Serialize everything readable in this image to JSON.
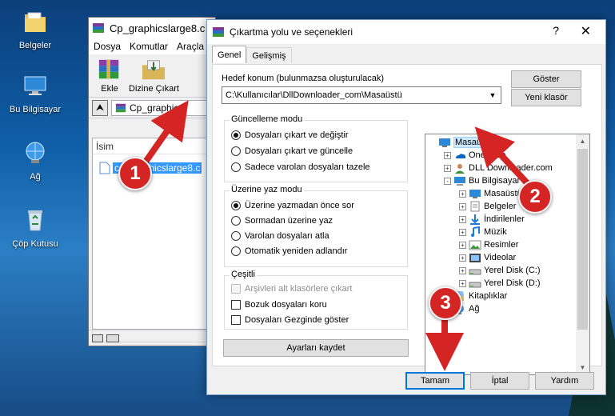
{
  "desktop": {
    "icons": [
      {
        "label": "Belgeler",
        "icon": "folder-documents-icon"
      },
      {
        "label": "Bu Bilgisayar",
        "icon": "computer-icon"
      },
      {
        "label": "Ağ",
        "icon": "network-icon"
      },
      {
        "label": "Çöp Kutusu",
        "icon": "recycle-bin-icon"
      }
    ]
  },
  "winrar": {
    "title": "Cp_graphicslarge8.c",
    "menu": [
      "Dosya",
      "Komutlar",
      "Araçla"
    ],
    "toolbar": {
      "add": "Ekle",
      "extract_to": "Dizine Çıkart"
    },
    "path": "Cp_graphic",
    "column": "İsim",
    "file": "cp_graphicslarge8.c"
  },
  "dialog": {
    "title": "Çıkartma yolu ve seçenekleri",
    "help": "?",
    "close": "✕",
    "tabs": [
      "Genel",
      "Gelişmiş"
    ],
    "dest_label": "Hedef konum (bulunmazsa oluşturulacak)",
    "dest_value": "C:\\Kullanıcılar\\DllDownloader_com\\Masaüstü",
    "show_btn": "Göster",
    "new_folder_btn": "Yeni klasör",
    "update_mode": {
      "title": "Güncelleme modu",
      "options": [
        "Dosyaları çıkart ve değiştir",
        "Dosyaları çıkart ve güncelle",
        "Sadece varolan dosyaları tazele"
      ],
      "selected": 0
    },
    "overwrite_mode": {
      "title": "Üzerine yaz modu",
      "options": [
        "Üzerine yazmadan önce sor",
        "Sormadan üzerine yaz",
        "Varolan dosyaları atla",
        "Otomatik yeniden adlandır"
      ],
      "selected": 0
    },
    "misc": {
      "title": "Çeşitli",
      "options": [
        "Arşivleri alt klasörlere çıkart",
        "Bozuk dosyaları koru",
        "Dosyaları Gezginde göster"
      ],
      "disabled": [
        true,
        false,
        false
      ]
    },
    "save_settings_btn": "Ayarları kaydet",
    "tree": [
      {
        "label": "Masaüstü",
        "level": 0,
        "exp": "",
        "icon": "desktop-icon",
        "selected": true
      },
      {
        "label": "OneDrive",
        "level": 1,
        "exp": "+",
        "icon": "onedrive-icon"
      },
      {
        "label": "DLL Downloader.com",
        "level": 1,
        "exp": "+",
        "icon": "user-icon"
      },
      {
        "label": "Bu Bilgisayar",
        "level": 1,
        "exp": "-",
        "icon": "computer-icon"
      },
      {
        "label": "Masaüstü",
        "level": 2,
        "exp": "+",
        "icon": "desktop-icon"
      },
      {
        "label": "Belgeler",
        "level": 2,
        "exp": "+",
        "icon": "documents-icon"
      },
      {
        "label": "İndirilenler",
        "level": 2,
        "exp": "+",
        "icon": "download-icon"
      },
      {
        "label": "Müzik",
        "level": 2,
        "exp": "+",
        "icon": "music-icon"
      },
      {
        "label": "Resimler",
        "level": 2,
        "exp": "+",
        "icon": "pictures-icon"
      },
      {
        "label": "Videolar",
        "level": 2,
        "exp": "+",
        "icon": "videos-icon"
      },
      {
        "label": "Yerel Disk (C:)",
        "level": 2,
        "exp": "+",
        "icon": "drive-icon"
      },
      {
        "label": "Yerel Disk (D:)",
        "level": 2,
        "exp": "+",
        "icon": "drive-icon"
      },
      {
        "label": "Kitaplıklar",
        "level": 1,
        "exp": "+",
        "icon": "libraries-icon"
      },
      {
        "label": "Ağ",
        "level": 1,
        "exp": "+",
        "icon": "network-icon"
      }
    ],
    "ok_btn": "Tamam",
    "cancel_btn": "İptal",
    "help_btn": "Yardım"
  },
  "callouts": [
    "1",
    "2",
    "3"
  ],
  "colors": {
    "callout": "#d42424",
    "selection": "#3399ff",
    "accent": "#0078d7"
  }
}
